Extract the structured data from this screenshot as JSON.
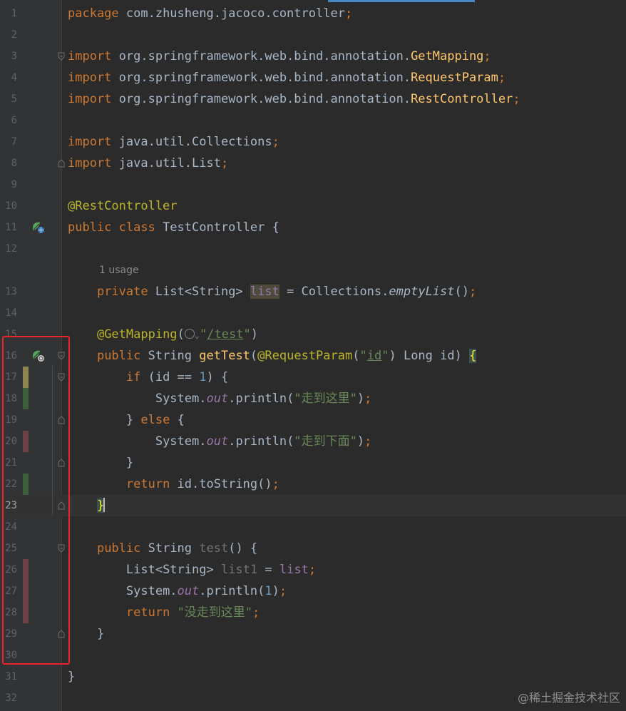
{
  "colors": {
    "background": "#2b2b2b",
    "gutter": "#313335",
    "keyword": "#cc7832",
    "annotation": "#bbb529",
    "string": "#6a8759",
    "number": "#6897bb",
    "field": "#9876aa",
    "method": "#ffc66d",
    "coverage_full": "#3f5e3c",
    "coverage_partial": "#8d8452",
    "coverage_none": "#6e4244",
    "highlight_box": "#e8242c"
  },
  "editor": {
    "line_numbers": [
      "1",
      "2",
      "3",
      "4",
      "5",
      "6",
      "7",
      "8",
      "9",
      "10",
      "11",
      "12",
      "13",
      "14",
      "15",
      "16",
      "17",
      "18",
      "19",
      "20",
      "21",
      "22",
      "23",
      "24",
      "25",
      "26",
      "27",
      "28",
      "29",
      "30",
      "31",
      "32"
    ],
    "current_line": "23",
    "usage_hint": "1 usage",
    "icons": {
      "class_gutter": "spring-bean-web-icon",
      "method_gutter": "spring-request-mapping-icon",
      "inline_hint": "globe-icon",
      "dropdown": "chevron-down-icon"
    },
    "code": {
      "l1": {
        "kw": "package",
        "rest": " com.zhusheng.jacoco.controller",
        "semi": ";"
      },
      "l3": {
        "kw": "import",
        "pkg": " org.springframework.web.bind.annotation.",
        "cls": "GetMapping",
        "semi": ";"
      },
      "l4": {
        "kw": "import",
        "pkg": " org.springframework.web.bind.annotation.",
        "cls": "RequestParam",
        "semi": ";"
      },
      "l5": {
        "kw": "import",
        "pkg": " org.springframework.web.bind.annotation.",
        "cls": "RestController",
        "semi": ";"
      },
      "l7": {
        "kw": "import",
        "rest": " java.util.Collections",
        "semi": ";"
      },
      "l8": {
        "kw": "import",
        "rest": " java.util.List",
        "semi": ";"
      },
      "l10": {
        "ann": "@RestController"
      },
      "l11": {
        "kw": "public class",
        "rest": " TestController {"
      },
      "l13": {
        "kw": "private",
        "type": " List<String> ",
        "var": "list",
        "eq": " = Collections.",
        "call": "emptyList",
        "end": "()",
        "semi": ";"
      },
      "l15": {
        "ann": "@GetMapping",
        "open": "(",
        "q1": "\"",
        "path": "/test",
        "q2": "\"",
        "close": ")"
      },
      "l16": {
        "kw": "public",
        "type": " String ",
        "name": "getTest",
        "open": "(",
        "ann": "@RequestParam",
        "p1": "(",
        "q1": "\"",
        "param": "id",
        "q2": "\"",
        "p2": ")",
        "tail": " Long id) ",
        "brace": "{"
      },
      "l17": {
        "kw": "if",
        "a": " (id == ",
        "num": "1",
        "b": ") {"
      },
      "l18": {
        "a": "System.",
        "out": "out",
        "b": ".println(",
        "str": "\"走到这里\"",
        "c": ")",
        "semi": ";"
      },
      "l19": {
        "a": "} ",
        "kw": "else",
        "b": " {"
      },
      "l20": {
        "a": "System.",
        "out": "out",
        "b": ".println(",
        "str": "\"走到下面\"",
        "c": ")",
        "semi": ";"
      },
      "l21": {
        "a": "}"
      },
      "l22": {
        "kw": "return",
        "a": " id.toString()",
        "semi": ";"
      },
      "l23": {
        "brace": "}"
      },
      "l25": {
        "kw": "public",
        "type": " String ",
        "name": "test",
        "a": "() {"
      },
      "l26": {
        "type": "List<String> ",
        "var": "list1",
        "eq": " = ",
        "fld": "list",
        "semi": ";"
      },
      "l27": {
        "a": "System.",
        "out": "out",
        "b": ".println(",
        "num": "1",
        "c": ")",
        "semi": ";"
      },
      "l28": {
        "kw": "return",
        "sp": " ",
        "str": "\"没走到这里\"",
        "semi": ";"
      },
      "l29": {
        "a": "}"
      },
      "l31": {
        "a": "}"
      }
    }
  },
  "watermark": "@稀土掘金技术社区"
}
